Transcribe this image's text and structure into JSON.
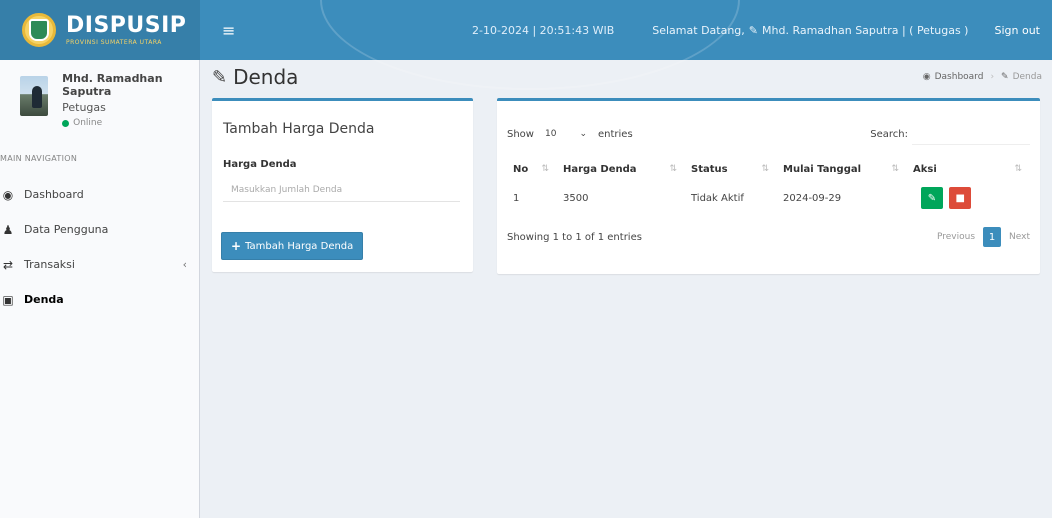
{
  "header": {
    "logo_main": "DISPUSIP",
    "logo_sub": "PROVINSI SUMATERA UTARA",
    "menu_icon": "hamburger-icon",
    "clock": "2-10-2024 | 20:51:43 WIB",
    "welcome": "Selamat Datang, ",
    "welcome_user": "Mhd. Ramadhan Saputra | ( Petugas )",
    "signout": "Sign out",
    "color": "#3c8dbc"
  },
  "sidebar": {
    "user_name": "Mhd. Ramadhan Saputra",
    "user_role": "Petugas",
    "status": "Online",
    "nav_header": "MAIN NAVIGATION",
    "items": [
      {
        "label": "Dashboard",
        "icon": "dashboard-icon"
      },
      {
        "label": "Data Pengguna",
        "icon": "user-icon"
      },
      {
        "label": "Transaksi",
        "icon": "exchange-icon"
      },
      {
        "label": "Denda",
        "icon": "money-icon"
      }
    ]
  },
  "content": {
    "title": "Denda",
    "breadcrumb": [
      "Dashboard",
      "Denda"
    ]
  },
  "form": {
    "title": "Tambah Harga Denda",
    "label": "Harga Denda",
    "placeholder": "Masukkan Jumlah Denda",
    "button": "Tambah Harga Denda"
  },
  "table": {
    "show_label": "Show",
    "length_value": "10",
    "entries_label": "entries",
    "search_label": "Search:",
    "columns": [
      "No",
      "Harga Denda",
      "Status",
      "Mulai Tanggal",
      "Aksi"
    ],
    "rows": [
      {
        "no": "1",
        "harga": "3500",
        "status": "Tidak Aktif",
        "tanggal": "2024-09-29"
      }
    ],
    "info": "Showing 1 to 1 of 1 entries",
    "previous": "Previous",
    "current_page": "1",
    "next": "Next"
  }
}
